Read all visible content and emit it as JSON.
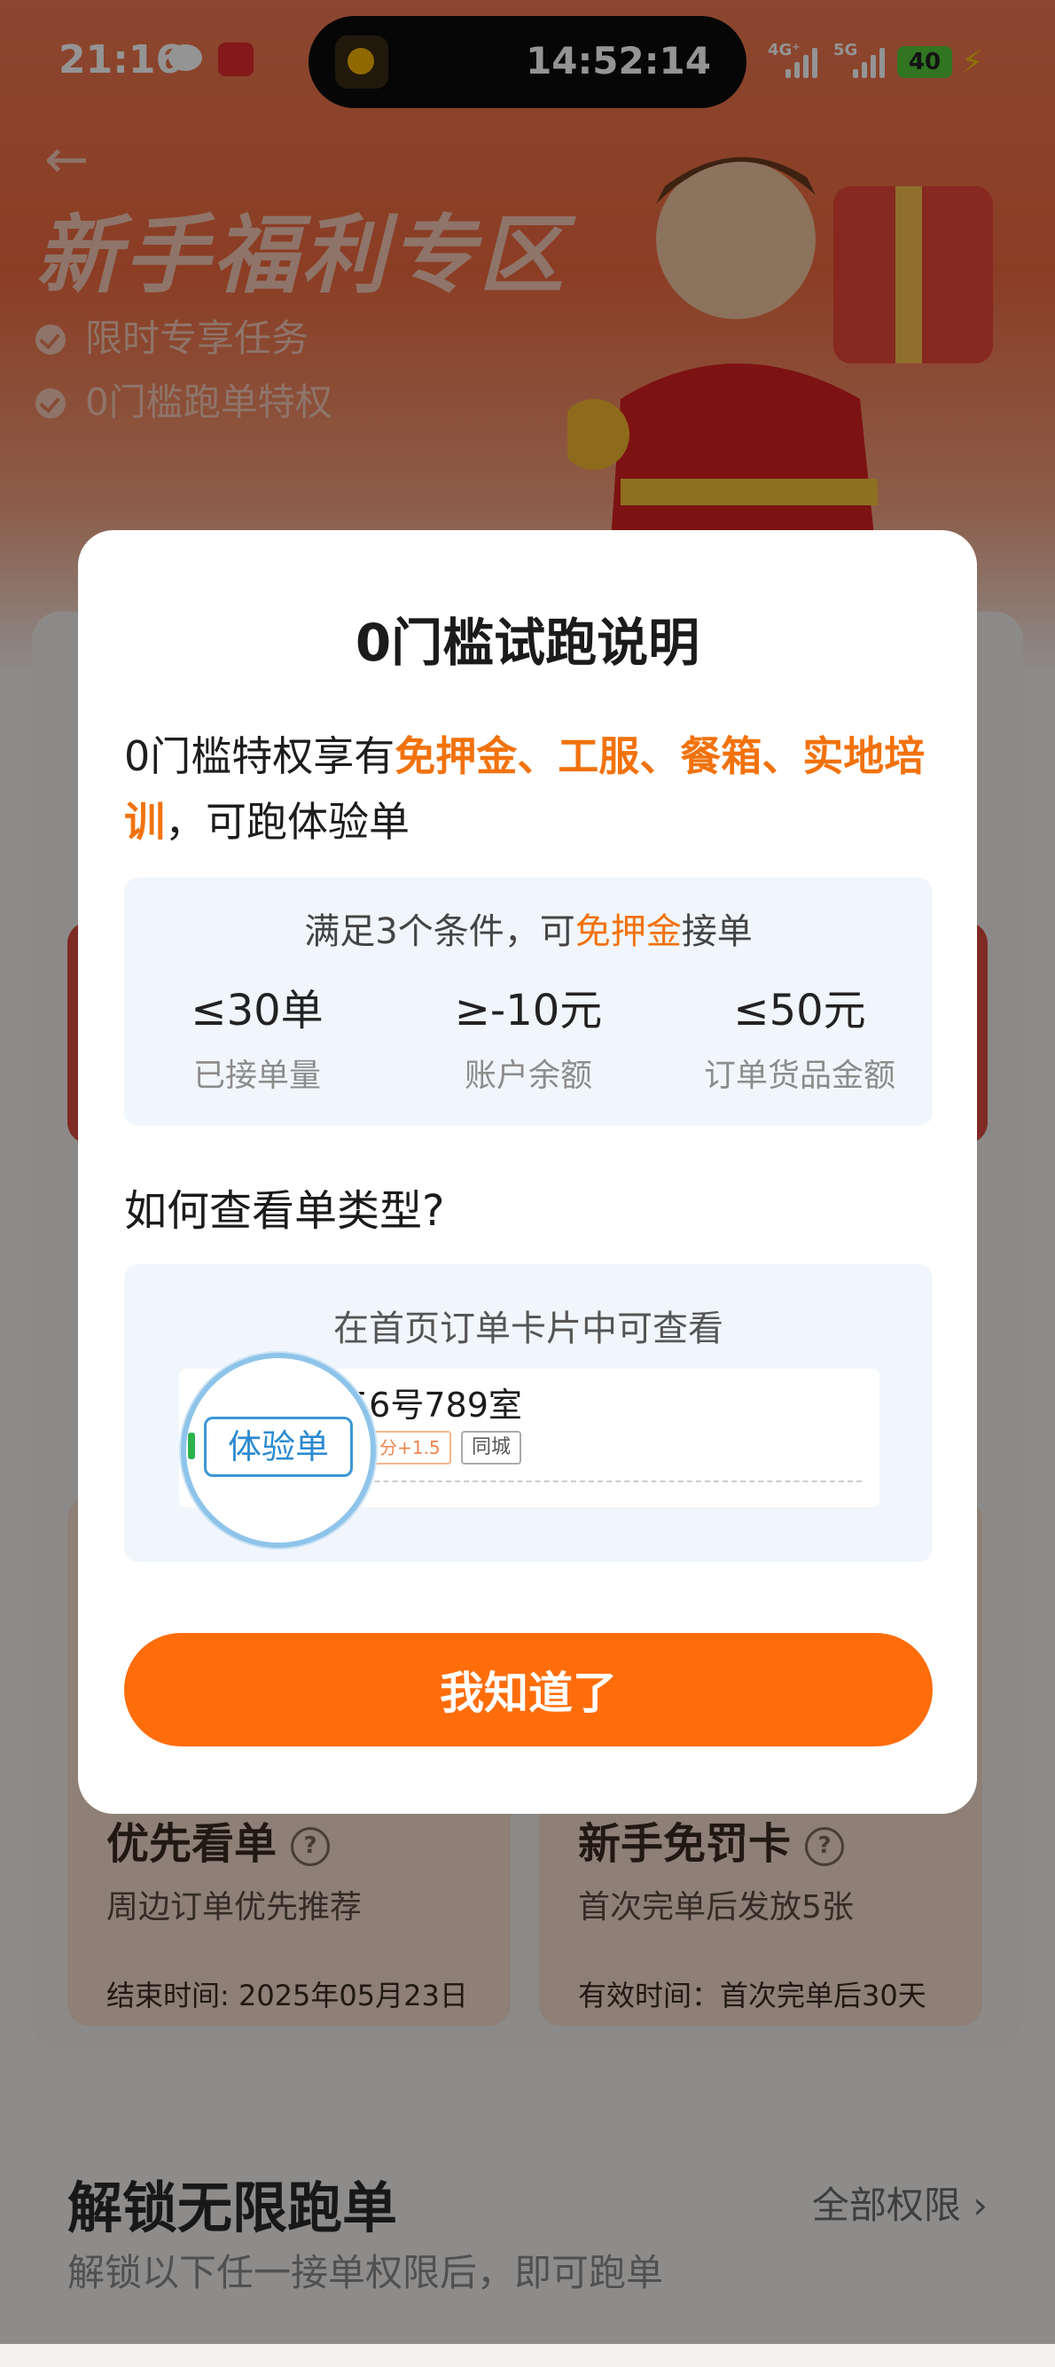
{
  "status_bar": {
    "time": "21:16",
    "timer_time": "14:52:14",
    "signal_1": "4G⁺",
    "signal_2": "5G",
    "battery": "40"
  },
  "hero": {
    "title": "新手福利专区",
    "points": [
      "限时专享任务",
      "0门槛跑单特权"
    ]
  },
  "features": [
    {
      "title": "优先看单",
      "subtitle": "周边订单优先推荐",
      "footer": "结束时间: 2025年05月23日"
    },
    {
      "title": "新手免罚卡",
      "subtitle": "首次完单后发放5张",
      "footer": "有效时间：首次完单后30天"
    }
  ],
  "unlock": {
    "title": "解锁无限跑单",
    "link": "全部权限 ›",
    "subtitle": "解锁以下任一接单权限后，即可跑单"
  },
  "modal": {
    "title": "0门槛试跑说明",
    "desc_prefix": "0门槛特权享有",
    "desc_highlight": "免押金、工服、餐箱、实地培训",
    "desc_suffix": "，可跑体验单",
    "conditions_head_prefix": "满足3个条件，可",
    "conditions_head_highlight": "免押金",
    "conditions_head_suffix": "接单",
    "conditions": [
      {
        "value": "≤30单",
        "label": "已接单量"
      },
      {
        "value": "≥-10元",
        "label": "账户余额"
      },
      {
        "value": "≤50元",
        "label": "订单货品金额"
      }
    ],
    "section_question": "如何查看单类型?",
    "view_head": "在首页订单卡片中可查看",
    "example": {
      "address_fragment": "56号789室",
      "tag_score": "分+1.5",
      "tag_city": "同城",
      "badge": "体验单"
    },
    "confirm_button": "我知道了"
  },
  "colors": {
    "accent": "#ff6d0b",
    "highlight_text": "#f2720d",
    "badge_blue": "#2b8ad0"
  }
}
